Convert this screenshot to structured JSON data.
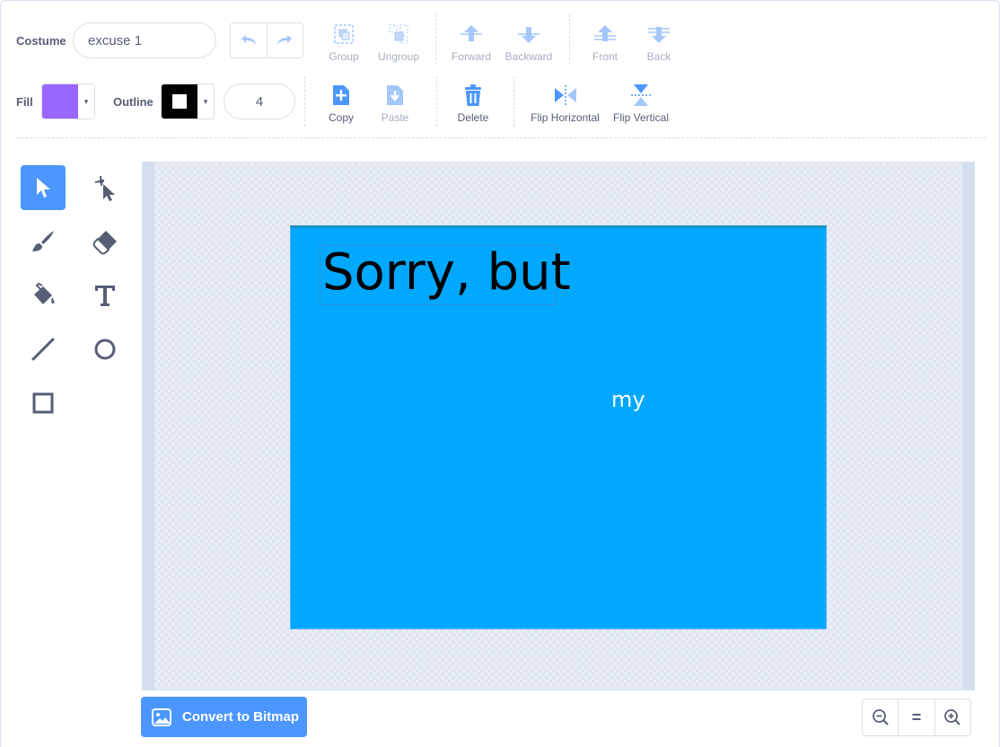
{
  "costume": {
    "label": "Costume",
    "name_value": "excuse 1"
  },
  "arrange": {
    "group": "Group",
    "ungroup": "Ungroup",
    "forward": "Forward",
    "backward": "Backward",
    "front": "Front",
    "back": "Back"
  },
  "fill": {
    "label": "Fill",
    "color": "#9966ff"
  },
  "outline": {
    "label": "Outline",
    "color": "#000000",
    "width_value": "4"
  },
  "edit": {
    "copy": "Copy",
    "paste": "Paste",
    "delete": "Delete",
    "flip_horizontal": "Flip Horizontal",
    "flip_vertical": "Flip Vertical"
  },
  "tools": [
    "select-tool",
    "reshape-tool",
    "brush-tool",
    "eraser-tool",
    "fill-tool",
    "text-tool",
    "line-tool",
    "circle-tool",
    "rectangle-tool"
  ],
  "canvas": {
    "costume_color": "#00a8ff",
    "text_large": "Sorry, but",
    "text_small": "my"
  },
  "footer": {
    "convert_label": "Convert to Bitmap",
    "zoom_reset": "="
  },
  "colors": {
    "accent": "#4c97ff",
    "text": "#575e75"
  }
}
